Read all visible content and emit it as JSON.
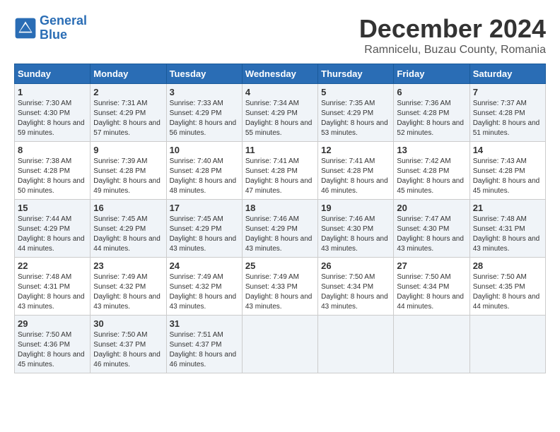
{
  "logo": {
    "line1": "General",
    "line2": "Blue"
  },
  "title": "December 2024",
  "location": "Ramnicelu, Buzau County, Romania",
  "weekdays": [
    "Sunday",
    "Monday",
    "Tuesday",
    "Wednesday",
    "Thursday",
    "Friday",
    "Saturday"
  ],
  "weeks": [
    [
      {
        "day": "1",
        "sunrise": "7:30 AM",
        "sunset": "4:30 PM",
        "daylight": "8 hours and 59 minutes."
      },
      {
        "day": "2",
        "sunrise": "7:31 AM",
        "sunset": "4:29 PM",
        "daylight": "8 hours and 57 minutes."
      },
      {
        "day": "3",
        "sunrise": "7:33 AM",
        "sunset": "4:29 PM",
        "daylight": "8 hours and 56 minutes."
      },
      {
        "day": "4",
        "sunrise": "7:34 AM",
        "sunset": "4:29 PM",
        "daylight": "8 hours and 55 minutes."
      },
      {
        "day": "5",
        "sunrise": "7:35 AM",
        "sunset": "4:29 PM",
        "daylight": "8 hours and 53 minutes."
      },
      {
        "day": "6",
        "sunrise": "7:36 AM",
        "sunset": "4:28 PM",
        "daylight": "8 hours and 52 minutes."
      },
      {
        "day": "7",
        "sunrise": "7:37 AM",
        "sunset": "4:28 PM",
        "daylight": "8 hours and 51 minutes."
      }
    ],
    [
      {
        "day": "8",
        "sunrise": "7:38 AM",
        "sunset": "4:28 PM",
        "daylight": "8 hours and 50 minutes."
      },
      {
        "day": "9",
        "sunrise": "7:39 AM",
        "sunset": "4:28 PM",
        "daylight": "8 hours and 49 minutes."
      },
      {
        "day": "10",
        "sunrise": "7:40 AM",
        "sunset": "4:28 PM",
        "daylight": "8 hours and 48 minutes."
      },
      {
        "day": "11",
        "sunrise": "7:41 AM",
        "sunset": "4:28 PM",
        "daylight": "8 hours and 47 minutes."
      },
      {
        "day": "12",
        "sunrise": "7:41 AM",
        "sunset": "4:28 PM",
        "daylight": "8 hours and 46 minutes."
      },
      {
        "day": "13",
        "sunrise": "7:42 AM",
        "sunset": "4:28 PM",
        "daylight": "8 hours and 45 minutes."
      },
      {
        "day": "14",
        "sunrise": "7:43 AM",
        "sunset": "4:28 PM",
        "daylight": "8 hours and 45 minutes."
      }
    ],
    [
      {
        "day": "15",
        "sunrise": "7:44 AM",
        "sunset": "4:29 PM",
        "daylight": "8 hours and 44 minutes."
      },
      {
        "day": "16",
        "sunrise": "7:45 AM",
        "sunset": "4:29 PM",
        "daylight": "8 hours and 44 minutes."
      },
      {
        "day": "17",
        "sunrise": "7:45 AM",
        "sunset": "4:29 PM",
        "daylight": "8 hours and 43 minutes."
      },
      {
        "day": "18",
        "sunrise": "7:46 AM",
        "sunset": "4:29 PM",
        "daylight": "8 hours and 43 minutes."
      },
      {
        "day": "19",
        "sunrise": "7:46 AM",
        "sunset": "4:30 PM",
        "daylight": "8 hours and 43 minutes."
      },
      {
        "day": "20",
        "sunrise": "7:47 AM",
        "sunset": "4:30 PM",
        "daylight": "8 hours and 43 minutes."
      },
      {
        "day": "21",
        "sunrise": "7:48 AM",
        "sunset": "4:31 PM",
        "daylight": "8 hours and 43 minutes."
      }
    ],
    [
      {
        "day": "22",
        "sunrise": "7:48 AM",
        "sunset": "4:31 PM",
        "daylight": "8 hours and 43 minutes."
      },
      {
        "day": "23",
        "sunrise": "7:49 AM",
        "sunset": "4:32 PM",
        "daylight": "8 hours and 43 minutes."
      },
      {
        "day": "24",
        "sunrise": "7:49 AM",
        "sunset": "4:32 PM",
        "daylight": "8 hours and 43 minutes."
      },
      {
        "day": "25",
        "sunrise": "7:49 AM",
        "sunset": "4:33 PM",
        "daylight": "8 hours and 43 minutes."
      },
      {
        "day": "26",
        "sunrise": "7:50 AM",
        "sunset": "4:34 PM",
        "daylight": "8 hours and 43 minutes."
      },
      {
        "day": "27",
        "sunrise": "7:50 AM",
        "sunset": "4:34 PM",
        "daylight": "8 hours and 44 minutes."
      },
      {
        "day": "28",
        "sunrise": "7:50 AM",
        "sunset": "4:35 PM",
        "daylight": "8 hours and 44 minutes."
      }
    ],
    [
      {
        "day": "29",
        "sunrise": "7:50 AM",
        "sunset": "4:36 PM",
        "daylight": "8 hours and 45 minutes."
      },
      {
        "day": "30",
        "sunrise": "7:50 AM",
        "sunset": "4:37 PM",
        "daylight": "8 hours and 46 minutes."
      },
      {
        "day": "31",
        "sunrise": "7:51 AM",
        "sunset": "4:37 PM",
        "daylight": "8 hours and 46 minutes."
      },
      null,
      null,
      null,
      null
    ]
  ]
}
